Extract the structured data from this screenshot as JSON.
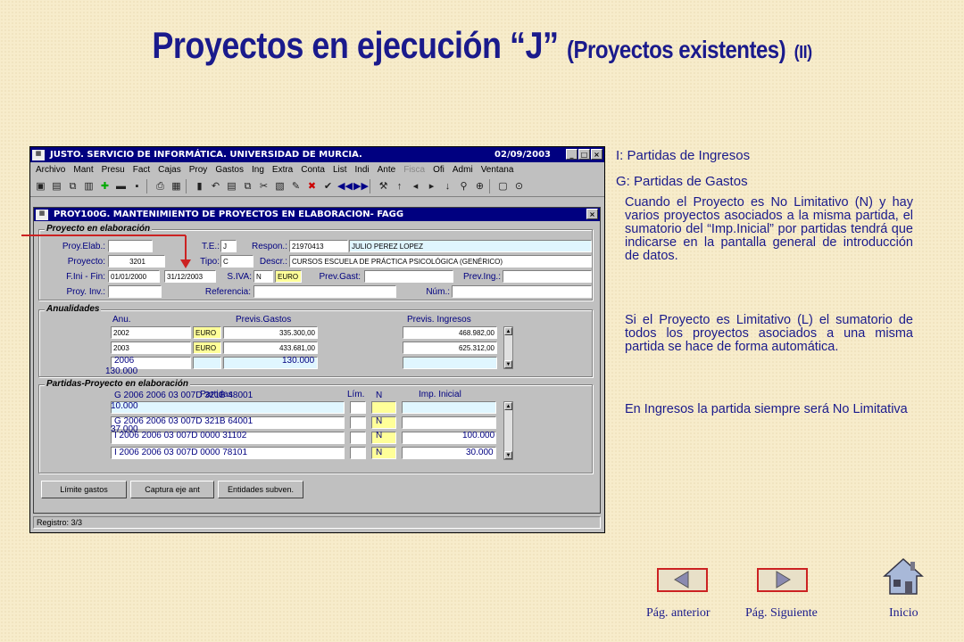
{
  "slide": {
    "title_main": "Proyectos en ejecución “J”",
    "title_sub": "(Proyectos existentes)",
    "title_part": "(II)"
  },
  "window": {
    "title": "JUSTO. SERVICIO DE INFORMÁTICA. UNIVERSIDAD DE MURCIA.",
    "date": "02/09/2003",
    "menu": [
      "Archivo",
      "Mant",
      "Presu",
      "Fact",
      "Cajas",
      "Proy",
      "Gastos",
      "Ing",
      "Extra",
      "Conta",
      "List",
      "Indi",
      "Ante",
      "Fisca",
      "Ofi",
      "Admi",
      "Ventana"
    ],
    "menu_disabled": "Fisca"
  },
  "form": {
    "title": "PROY100G. MANTENIMIENTO DE PROYECTOS EN ELABORACION- FAGG",
    "section1": "Proyecto en elaboración",
    "labels": {
      "proy_elab": "Proy.Elab.:",
      "te": "T.E.:",
      "respon": "Respon.:",
      "proyecto": "Proyecto:",
      "tipo": "Tipo:",
      "descr": "Descr.:",
      "fini": "F.Ini - Fin:",
      "siva": "S.IVA:",
      "prev_gast": "Prev.Gast:",
      "prev_ing": "Prev.Ing.:",
      "proy_inv": "Proy. Inv.:",
      "referencia": "Referencia:",
      "num": "Núm.:"
    },
    "values": {
      "te": "J",
      "respon_code": "21970413",
      "respon_name": "JULIO PEREZ LOPEZ",
      "proyecto": "3201",
      "tipo": "C",
      "descr": "CURSOS ESCUELA DE PRÁCTICA PSICOLÓGICA (GENÉRICO)",
      "fini": "01/01/2000",
      "ffin": "31/12/2003",
      "siva": "N",
      "euro": "EURO"
    },
    "section2": "Anualidades",
    "anual_headers": [
      "Anu.",
      "Previs.Gastos",
      "Previs. Ingresos"
    ],
    "anualidades": [
      {
        "year": "2002",
        "cur": "EURO",
        "gastos": "335.300,00",
        "ingresos": "468.982,00"
      },
      {
        "year": "2003",
        "cur": "EURO",
        "gastos": "433.681,00",
        "ingresos": "625.312,00"
      }
    ],
    "anual_ghost": {
      "year": "2006",
      "amount1": "130.000",
      "amount2": "130.000"
    },
    "section3": "Partidas-Proyecto en elaboración",
    "part_headers": {
      "partidas": "Partidas",
      "lim": "Lím.",
      "imp": "Imp. Inicial"
    },
    "partidas_ghost": [
      {
        "text": "G   2006   2006  03  007D  321B    48001",
        "lim": "N",
        "imp": "10.000"
      },
      {
        "text": "G   2006   2006  03  007D  321B   64001",
        "lim": "N",
        "imp": ""
      },
      {
        "text": "I   2006   2006  03  007D  0000    31102",
        "lim": "N",
        "imp": "100.000"
      },
      {
        "text": "I   2006   2006  03  007D  0000    78101",
        "lim": "N",
        "imp": "30.000"
      }
    ],
    "ghost_misc": "37.000",
    "buttons": [
      "Límite gastos",
      "Captura eje ant",
      "Entidades subven."
    ],
    "status": "Registro: 3/3"
  },
  "side": {
    "legend_i": "I: Partidas de Ingresos",
    "legend_g": "G: Partidas de Gastos",
    "p1": "Cuando el Proyecto es No Limitativo (N) y hay varios proyectos asociados a la misma partida, el sumatorio del “Imp.Inicial” por partidas tendrá que indicarse en la pantalla general de introducción de datos.",
    "p2": "Si el Proyecto es Limitativo (L) el sumatorio de todos los proyectos asociados a una misma partida se hace de forma automática.",
    "p3": "En Ingresos la partida siempre será No Limitativa"
  },
  "nav": {
    "prev": "Pág. anterior",
    "next": "Pág. Siguiente",
    "home": "Inicio"
  },
  "colors": {
    "title": "#1a1a8c",
    "window_title": "#000080",
    "arrow": "#cc2222"
  }
}
